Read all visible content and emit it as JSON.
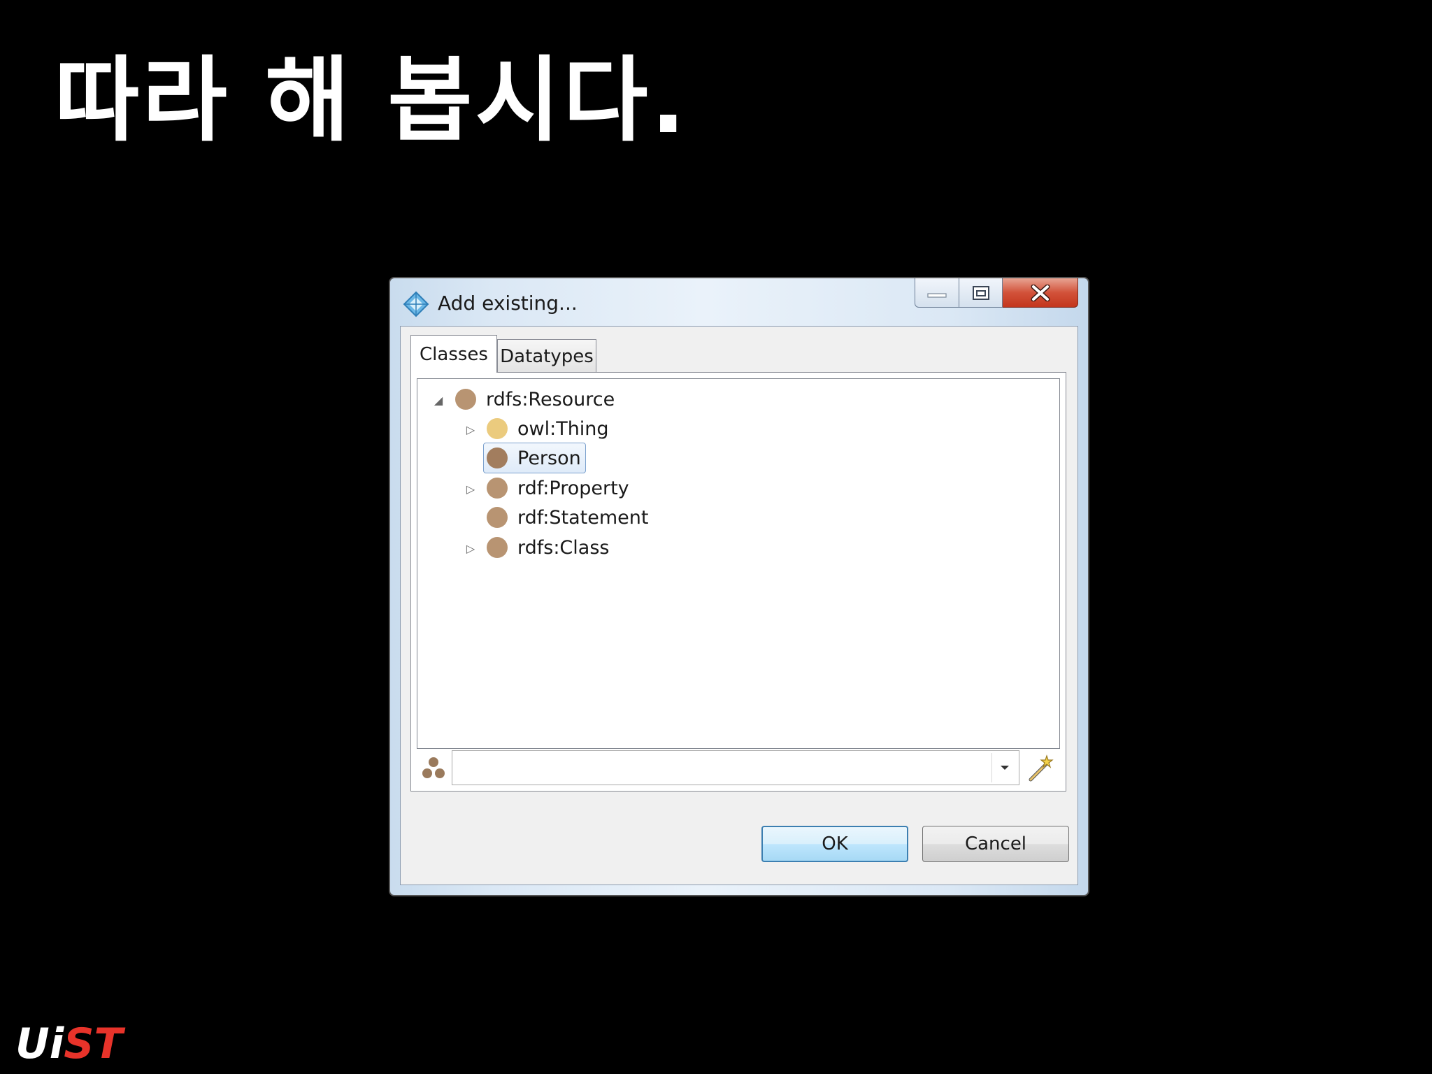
{
  "slide": {
    "title": "따라 해 봅시다.",
    "logo_left": "Ui",
    "logo_right": "ST"
  },
  "dialog": {
    "title": "Add existing...",
    "tabs": [
      {
        "label": "Classes",
        "active": true
      },
      {
        "label": "Datatypes",
        "active": false
      }
    ],
    "tree": [
      {
        "label": "rdfs:Resource",
        "level": 0,
        "state": "expanded",
        "color": "#b89472"
      },
      {
        "label": "owl:Thing",
        "level": 1,
        "state": "collapsed",
        "color": "#ebcb7e"
      },
      {
        "label": "Person",
        "level": 1,
        "state": "leaf",
        "color": "#a27d5e",
        "selected": true
      },
      {
        "label": "rdf:Property",
        "level": 1,
        "state": "collapsed",
        "color": "#b89472"
      },
      {
        "label": "rdf:Statement",
        "level": 1,
        "state": "leaf",
        "color": "#b89472"
      },
      {
        "label": "rdfs:Class",
        "level": 1,
        "state": "collapsed",
        "color": "#b89472"
      }
    ],
    "search": {
      "value": "",
      "placeholder": ""
    },
    "icons": {
      "app": "diamond-app-icon",
      "cluster": "class-cluster-icon",
      "wand": "wand-icon"
    },
    "ok_label": "OK",
    "cancel_label": "Cancel"
  }
}
